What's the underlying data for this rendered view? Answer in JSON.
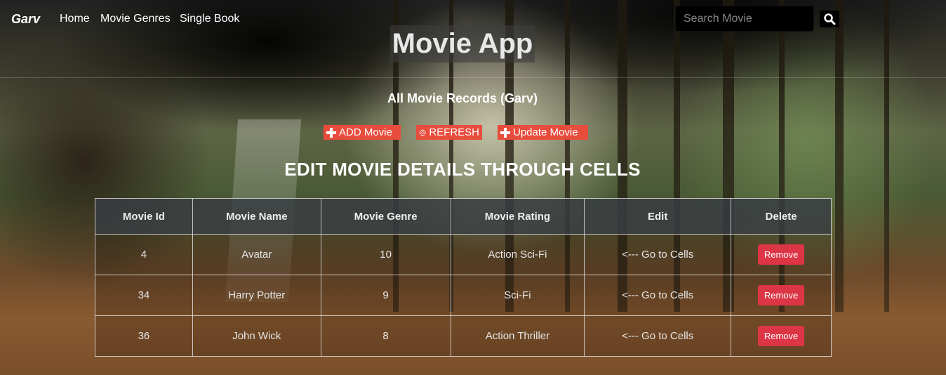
{
  "navbar": {
    "brand": "Garv",
    "links": [
      "Home",
      "Movie Genres",
      "Single Book"
    ],
    "search_placeholder": "Search Movie"
  },
  "app_title": "Movie App",
  "records_title": "All Movie Records (Garv)",
  "buttons": {
    "add": "ADD Movie",
    "refresh": "REFRESH",
    "update": "Update Movie"
  },
  "section_title": "EDIT MOVIE DETAILS THROUGH CELLS",
  "table": {
    "headers": [
      "Movie Id",
      "Movie Name",
      "Movie Genre",
      "Movie Rating",
      "Edit",
      "Delete"
    ],
    "rows": [
      {
        "id": "4",
        "name": "Avatar",
        "genre": "10",
        "rating": "Action Sci-Fi",
        "edit": "<--- Go to Cells",
        "delete": "Remove"
      },
      {
        "id": "34",
        "name": "Harry Potter",
        "genre": "9",
        "rating": "Sci-Fi",
        "edit": "<--- Go to Cells",
        "delete": "Remove"
      },
      {
        "id": "36",
        "name": "John Wick",
        "genre": "8",
        "rating": "Action Thriller",
        "edit": "<--- Go to Cells",
        "delete": "Remove"
      }
    ]
  },
  "colors": {
    "button_red": "#e74c3c",
    "remove_red": "#dc3545",
    "header_bg": "#373c42"
  }
}
